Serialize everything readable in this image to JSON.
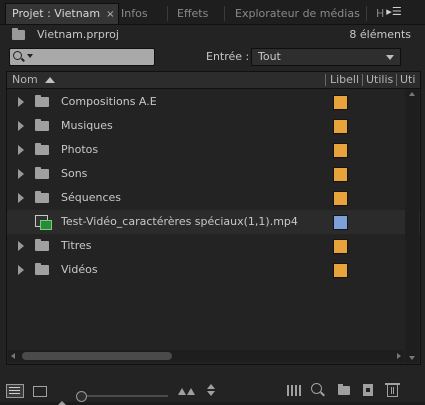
{
  "tabs": [
    {
      "label": "Projet : Vietnam",
      "close": "×",
      "active": true
    },
    {
      "label": "Infos"
    },
    {
      "label": "Effets"
    },
    {
      "label": "Explorateur de médias"
    },
    {
      "label": "H"
    }
  ],
  "tab_menu_icon": "panel-menu-icon",
  "project": {
    "filename": "Vietnam.prproj",
    "item_count": "8 éléments"
  },
  "filter": {
    "search_value": "",
    "entree_label": "Entrée :",
    "entree_value": "Tout"
  },
  "columns": {
    "name": "Nom",
    "label": "Libell",
    "usage": "Utilis",
    "third": "Uti"
  },
  "items": [
    {
      "name": "Compositions A.E",
      "type": "bin",
      "label_color": "#e8a43a"
    },
    {
      "name": "Musiques",
      "type": "bin",
      "label_color": "#e8a43a"
    },
    {
      "name": "Photos",
      "type": "bin",
      "label_color": "#e8a43a"
    },
    {
      "name": "Sons",
      "type": "bin",
      "label_color": "#e8a43a"
    },
    {
      "name": "Séquences",
      "type": "bin",
      "label_color": "#e8a43a"
    },
    {
      "name": "Test-Vidéo_caractérères spéciaux(1,1).mp4",
      "type": "media",
      "label_color": "#7da0d8"
    },
    {
      "name": "Titres",
      "type": "bin",
      "label_color": "#e8a43a"
    },
    {
      "name": "Vidéos",
      "type": "bin",
      "label_color": "#e8a43a"
    }
  ],
  "zoom": {
    "level": 0
  }
}
